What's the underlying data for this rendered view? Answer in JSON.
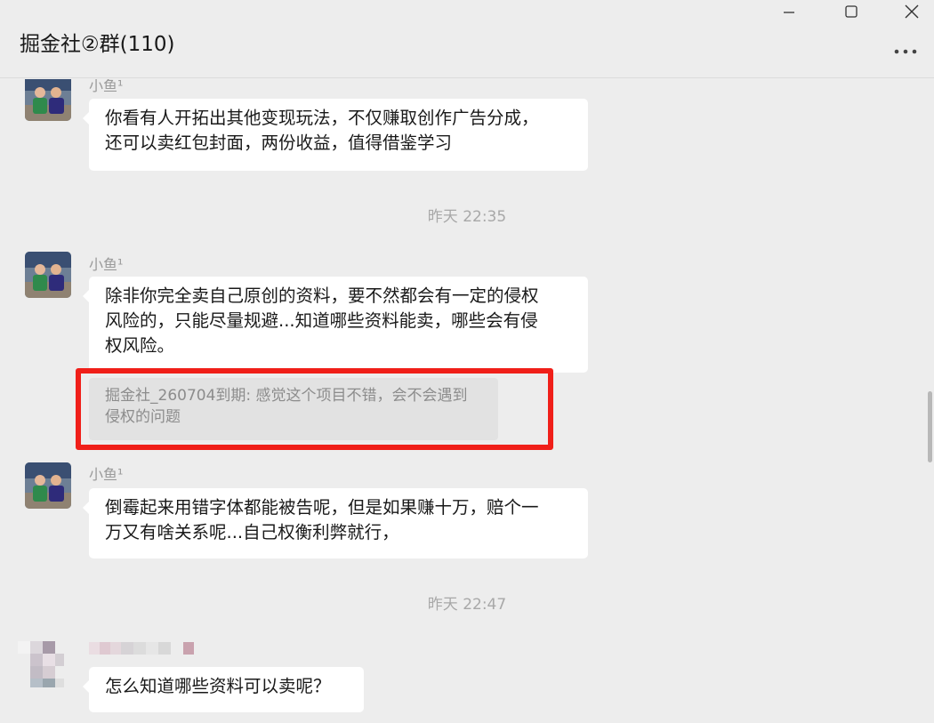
{
  "window": {
    "title": "掘金社②群(110)",
    "icons": [
      "minimize-icon",
      "maximize-icon",
      "close-icon",
      "more-icon"
    ]
  },
  "timestamps": [
    "昨天 22:35",
    "昨天 22:47"
  ],
  "messages": [
    {
      "sender": "小鱼¹",
      "lines": [
        "你看有人开拓出其他变现玩法，不仅赚取创作广告分成，",
        "还可以卖红包封面，两份收益，值得借鉴学习"
      ]
    },
    {
      "sender": "小鱼¹",
      "lines": [
        "除非你完全卖自己原创的资料，要不然都会有一定的侵权",
        "风险的，只能尽量规避...知道哪些资料能卖，哪些会有侵",
        "权风险。"
      ],
      "quote_lines": [
        "掘金社_260704到期: 感觉这个项目不错，会不会遇到",
        "侵权的问题"
      ]
    },
    {
      "sender": "小鱼¹",
      "lines": [
        "倒霉起来用错字体都能被告呢，但是如果赚十万，赔个一",
        "万又有啥关系呢...自己权衡利弊就行，"
      ]
    },
    {
      "sender": "",
      "lines": [
        "怎么知道哪些资料可以卖呢？"
      ]
    }
  ],
  "colors": {
    "background": "#ededed",
    "bubble": "#ffffff",
    "quote": "#e2e2e2",
    "highlight_box": "#f01f19"
  }
}
